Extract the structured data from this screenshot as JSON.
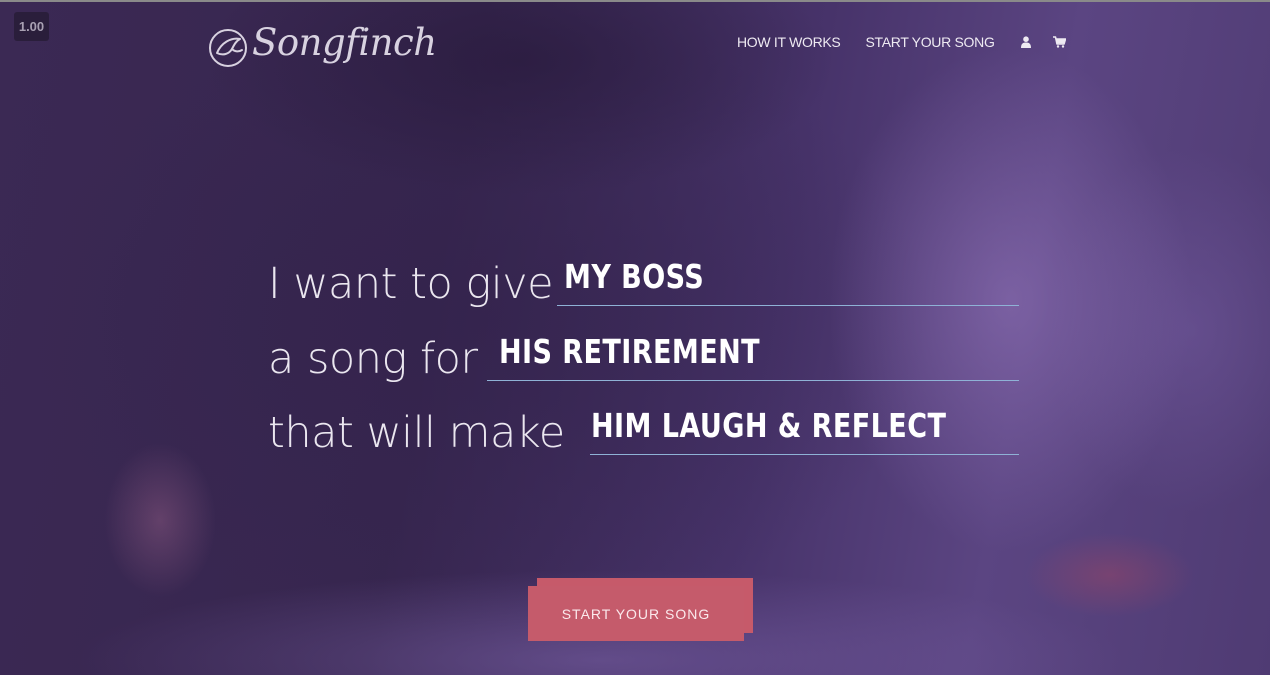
{
  "zoom_level": "1.00",
  "brand": {
    "name": "Songfinch",
    "logo_icon": "bird-circle-icon"
  },
  "nav": {
    "how_it_works": "HOW IT WORKS",
    "start_your_song": "START YOUR SONG",
    "account_icon": "user-icon",
    "cart_icon": "cart-icon"
  },
  "hero": {
    "lines": [
      {
        "phrase": "I want to give",
        "value": "MY BOSS"
      },
      {
        "phrase": "a song for",
        "value": "HIS RETIREMENT"
      },
      {
        "phrase": "that will make",
        "value": "HIM LAUGH & REFLECT"
      }
    ],
    "cta_label": "START YOUR SONG"
  },
  "colors": {
    "background": "#3a2852",
    "underline": "#8fb2d6",
    "cta": "#c55b6b"
  }
}
